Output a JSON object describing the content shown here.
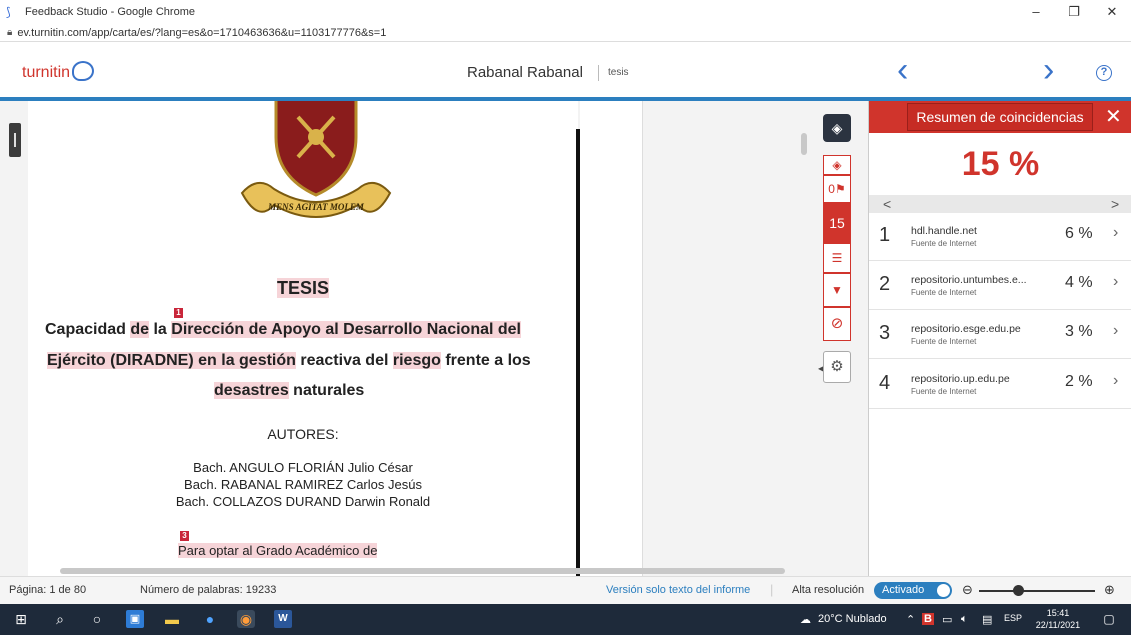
{
  "window": {
    "title": "Feedback Studio - Google Chrome",
    "url": "ev.turnitin.com/app/carta/es/?lang=es&o=1710463636&u=1103177776&s=1"
  },
  "header": {
    "logo_text": "turnitin",
    "doc_title": "Rabanal Rabanal",
    "doc_subtitle": "tesis",
    "prev_glyph": "‹",
    "next_glyph": "›",
    "help_glyph": "?"
  },
  "document": {
    "crest_motto": "MENS AGITAT MOLEM",
    "heading": "TESIS",
    "marker1": "1",
    "line1_parts": [
      {
        "text": "Capacidad ",
        "hl": false
      },
      {
        "text": "de",
        "hl": true
      },
      {
        "text": " la ",
        "hl": false
      },
      {
        "text": "Dirección de Apoyo al Desarrollo Nacional del",
        "hl": true
      }
    ],
    "line2_parts": [
      {
        "text": "Ejército (DIRADNE) en la gestión",
        "hl": true
      },
      {
        "text": " reactiva del ",
        "hl": false
      },
      {
        "text": "riesgo",
        "hl": true
      },
      {
        "text": " frente a los",
        "hl": false
      }
    ],
    "line3_parts": [
      {
        "text": "desastres",
        "hl": true
      },
      {
        "text": " naturales",
        "hl": false
      }
    ],
    "authors_label": "AUTORES:",
    "authors": [
      "Bach. ANGULO FLORIÁN Julio César",
      "Bach. RABANAL RAMIREZ Carlos Jesús",
      "Bach. COLLAZOS DURAND Darwin Ronald"
    ],
    "marker3": "3",
    "optar_text": "Para optar al Grado Académico de"
  },
  "toolbar": {
    "layers_glyph": "◈",
    "flag_count": "0",
    "match_count": "15",
    "settings_glyph": "⚙"
  },
  "panel": {
    "title": "Resumen de coincidencias",
    "close_glyph": "✕",
    "similarity": "15 %",
    "pager_prev": "<",
    "pager_next": ">",
    "matches": [
      {
        "num": "1",
        "source": "hdl.handle.net",
        "type": "Fuente de Internet",
        "pct": "6 %"
      },
      {
        "num": "2",
        "source": "repositorio.untumbes.e...",
        "type": "Fuente de Internet",
        "pct": "4 %"
      },
      {
        "num": "3",
        "source": "repositorio.esge.edu.pe",
        "type": "Fuente de Internet",
        "pct": "3 %"
      },
      {
        "num": "4",
        "source": "repositorio.up.edu.pe",
        "type": "Fuente de Internet",
        "pct": "2 %"
      }
    ]
  },
  "statusbar": {
    "page": "Página: 1 de 80",
    "words": "Número de palabras: 19233",
    "text_only": "Versión solo texto del informe",
    "hires_label": "Alta resolución",
    "hires_state": "Activado"
  },
  "taskbar": {
    "weather": "20°C Nublado",
    "lang": "ESP",
    "time": "15:41",
    "date": "22/11/2021"
  }
}
